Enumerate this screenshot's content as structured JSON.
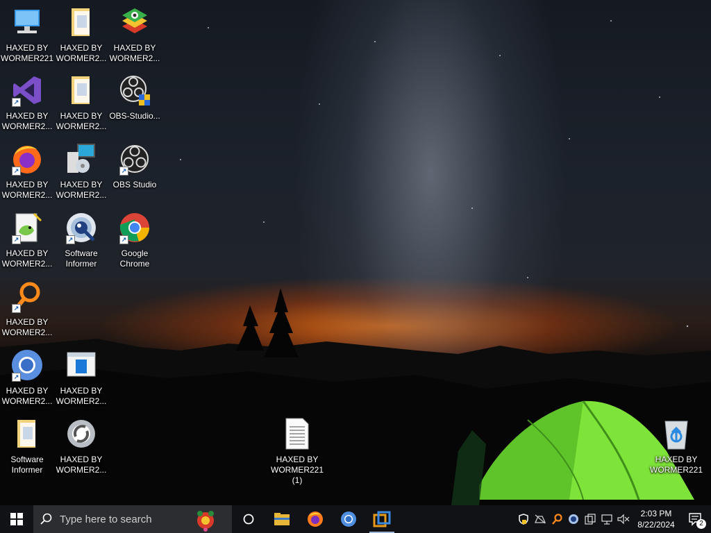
{
  "desktop": {
    "icons": [
      {
        "label": "HAXED BY\nWORMER221",
        "icon": "computer-icon"
      },
      {
        "label": "HAXED BY\nWORMER2...",
        "icon": "folder-icon"
      },
      {
        "label": "HAXED BY\nWORMER2...",
        "icon": "bluestacks-icon"
      },
      {
        "label": "HAXED BY\nWORMER2...",
        "icon": "visual-studio-icon"
      },
      {
        "label": "HAXED BY\nWORMER2...",
        "icon": "folder-icon"
      },
      {
        "label": "OBS-Studio...",
        "icon": "obs-installer-icon"
      },
      {
        "label": "HAXED BY\nWORMER2...",
        "icon": "firefox-icon"
      },
      {
        "label": "HAXED BY\nWORMER2...",
        "icon": "setup-icon"
      },
      {
        "label": "OBS Studio",
        "icon": "obs-icon"
      },
      {
        "label": "HAXED BY\nWORMER2...",
        "icon": "notepad-plus-icon"
      },
      {
        "label": "Software\nInformer",
        "icon": "software-informer-icon"
      },
      {
        "label": "Google\nChrome",
        "icon": "chrome-icon"
      },
      {
        "label": "HAXED BY\nWORMER2...",
        "icon": "search-magnifier-icon"
      },
      {
        "label": "HAXED BY\nWORMER2...",
        "icon": "chromium-icon"
      },
      {
        "label": "HAXED BY\nWORMER2...",
        "icon": "window-app-icon"
      },
      {
        "label": "Software\nInformer",
        "icon": "folder-icon"
      },
      {
        "label": "HAXED BY\nWORMER2...",
        "icon": "ccleaner-icon"
      },
      {
        "label": "HAXED BY\nWORMER221\n(1)",
        "icon": "text-document-icon"
      },
      {
        "label": "HAXED BY\nWORMER221",
        "icon": "recycle-bin-icon"
      }
    ]
  },
  "taskbar": {
    "search_placeholder": "Type here to search",
    "pinned": [
      "file-explorer-icon",
      "firefox-icon",
      "chromium-icon",
      "virtualbox-icon"
    ],
    "tray_icons": [
      "windows-security-icon",
      "network-off-icon",
      "search-magnifier-icon",
      "software-informer-icon",
      "copy-icon",
      "network-icon",
      "volume-muted-icon"
    ],
    "time": "2:03 PM",
    "date": "8/22/2024",
    "notification_count": "2"
  }
}
